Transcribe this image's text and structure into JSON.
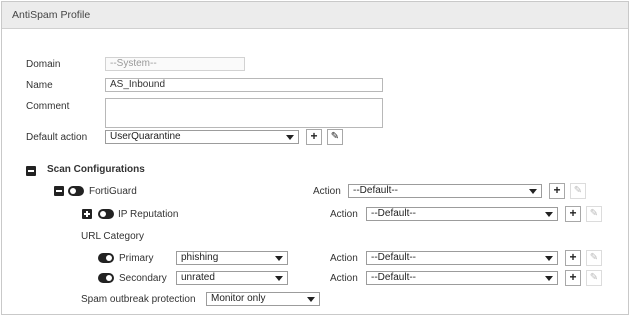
{
  "panel": {
    "title": "AntiSpam Profile"
  },
  "form": {
    "domain_label": "Domain",
    "domain_value": "--System--",
    "name_label": "Name",
    "name_value": "AS_Inbound",
    "comment_label": "Comment",
    "comment_value": "",
    "default_action_label": "Default action",
    "default_action_value": "UserQuarantine"
  },
  "scan": {
    "section_label": "Scan Configurations",
    "fortiguard_label": "FortiGuard",
    "ip_reputation_label": "IP Reputation",
    "url_category_label": "URL Category",
    "primary_label": "Primary",
    "primary_value": "phishing",
    "secondary_label": "Secondary",
    "secondary_value": "unrated",
    "spam_outbreak_label": "Spam outbreak protection",
    "spam_outbreak_value": "Monitor only",
    "action_label": "Action",
    "action_value": "--Default--",
    "toggles": {
      "fortiguard": "on",
      "ip_reputation": "on",
      "primary": "off",
      "secondary": "off"
    }
  },
  "buttons": {
    "add": "+",
    "edit": "✎"
  },
  "colors": {
    "title_bg": "#ececec",
    "border": "#c9c9c9",
    "icon": "#222222"
  }
}
